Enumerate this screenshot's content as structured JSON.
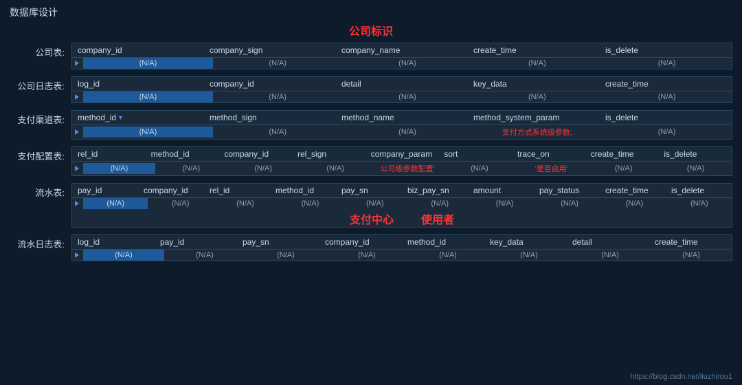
{
  "pageTitle": "数据库设计",
  "centerLabel": "公司标识",
  "footerUrl": "https://blog.csdn.net/liuzhirou1",
  "tables": [
    {
      "label": "公司表:",
      "columns": [
        "company_id",
        "company_sign",
        "company_name",
        "create_time",
        "is_delete"
      ],
      "data": [
        "(N/A)",
        "(N/A)",
        "(N/A)",
        "(N/A)",
        "(N/A)"
      ],
      "highlightedCol": 0,
      "redCols": [],
      "annotations": []
    },
    {
      "label": "公司日志表:",
      "columns": [
        "log_id",
        "company_id",
        "detail",
        "key_data",
        "create_time"
      ],
      "data": [
        "(N/A)",
        "(N/A)",
        "(N/A)",
        "(N/A)",
        "(N/A)"
      ],
      "highlightedCol": 0,
      "redCols": [],
      "annotations": []
    },
    {
      "label": "支付渠道表:",
      "columns": [
        "method_id",
        "method_sign",
        "method_name",
        "method_system_param",
        "is_delete"
      ],
      "data": [
        "(N/A)",
        "(N/A)",
        "(N/A)",
        "支付方式系统级参数,",
        "(N/A)"
      ],
      "highlightedCol": 0,
      "redCols": [
        3
      ],
      "pkArrow": true,
      "annotations": []
    },
    {
      "label": "支付配置表:",
      "columns": [
        "rel_id",
        "method_id",
        "company_id",
        "rel_sign",
        "company_param",
        "sort",
        "trace_on",
        "create_time",
        "is_delete"
      ],
      "data": [
        "(N/A)",
        "(N/A)",
        "(N/A)",
        "(N/A)",
        "公司级参数配置'",
        "(N/A)",
        "'是否启用'",
        "(N/A)",
        "(N/A)"
      ],
      "highlightedCol": 0,
      "redCols": [
        4,
        6
      ],
      "annotations": []
    },
    {
      "label": "流水表:",
      "columns": [
        "pay_id",
        "company_id",
        "rel_id",
        "method_id",
        "pay_sn",
        "biz_pay_sn",
        "amount",
        "pay_status",
        "create_time",
        "is_delete"
      ],
      "data": [
        "(N/A)",
        "(N/A)",
        "(N/A)",
        "(N/A)",
        "(N/A)",
        "(N/A)",
        "(N/A)",
        "(N/A)",
        "(N/A)",
        "(N/A)"
      ],
      "highlightedCol": 0,
      "redCols": [],
      "annotations": [
        "支付中心",
        "使用者"
      ]
    },
    {
      "label": "流水日志表:",
      "columns": [
        "log_id",
        "pay_id",
        "pay_sn",
        "company_id",
        "method_id",
        "key_data",
        "detail",
        "create_time"
      ],
      "data": [
        "(N/A)",
        "(N/A)",
        "(N/A)",
        "(N/A)",
        "(N/A)",
        "(N/A)",
        "(N/A)",
        "(N/A)"
      ],
      "highlightedCol": 0,
      "redCols": [],
      "annotations": []
    }
  ]
}
